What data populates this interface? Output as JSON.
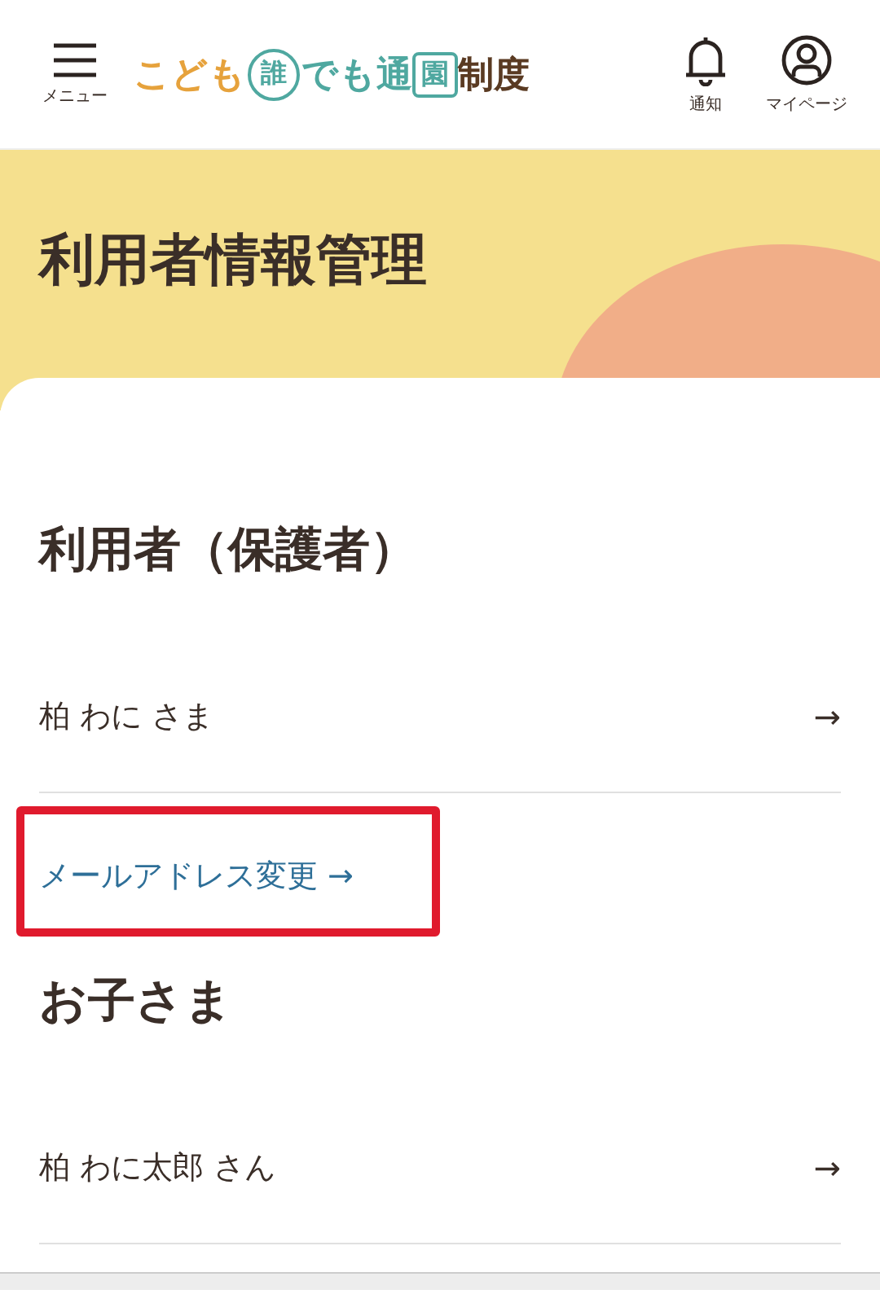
{
  "header": {
    "menu_label": "メニュー",
    "logo": [
      {
        "text": "こども",
        "kind": "plain",
        "color": "#e6a23c"
      },
      {
        "text": "誰",
        "kind": "circle",
        "color": "#4fa8a0"
      },
      {
        "text": "でも通",
        "kind": "plain",
        "color": "#4fa8a0"
      },
      {
        "text": "園",
        "kind": "box",
        "color": "#4fa8a0"
      },
      {
        "text": "制度",
        "kind": "plain",
        "color": "#5a3a22"
      }
    ],
    "actions": [
      {
        "kind": "bell",
        "label": "通知"
      },
      {
        "kind": "person",
        "label": "マイページ"
      }
    ]
  },
  "page_title": "利用者情報管理",
  "sections": [
    {
      "heading": "利用者（保護者）",
      "rows": [
        {
          "kind": "row",
          "text": "柏 わに さま",
          "arrow": "→"
        },
        {
          "kind": "link",
          "text": "メールアドレス変更",
          "arrow": "→",
          "highlighted": true
        }
      ]
    },
    {
      "heading": "お子さま",
      "rows": [
        {
          "kind": "row",
          "text": "柏 わに太郎 さん",
          "arrow": "→"
        }
      ]
    }
  ]
}
